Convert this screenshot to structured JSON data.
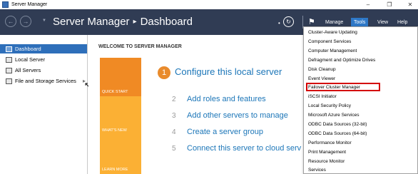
{
  "window": {
    "title": "Server Manager"
  },
  "header": {
    "breadcrumb_app": "Server Manager",
    "breadcrumb_separator": "▸",
    "breadcrumb_page": "Dashboard",
    "menus": [
      {
        "label": "Manage"
      },
      {
        "label": "Tools"
      },
      {
        "label": "View"
      },
      {
        "label": "Help"
      }
    ]
  },
  "sidebar": {
    "items": [
      {
        "label": "Dashboard"
      },
      {
        "label": "Local Server"
      },
      {
        "label": "All Servers"
      },
      {
        "label": "File and Storage Services"
      }
    ]
  },
  "main": {
    "welcome_heading": "WELCOME TO SERVER MANAGER",
    "tiles": [
      {
        "label": "QUICK START"
      },
      {
        "label": "WHAT'S NEW"
      },
      {
        "label": "LEARN MORE"
      }
    ],
    "steps": [
      {
        "number": "1",
        "text": "Configure this local server"
      },
      {
        "number": "2",
        "text": "Add roles and features"
      },
      {
        "number": "3",
        "text": "Add other servers to manage"
      },
      {
        "number": "4",
        "text": "Create a server group"
      },
      {
        "number": "5",
        "text": "Connect this server to cloud serv"
      }
    ]
  },
  "tools_menu": {
    "items": [
      {
        "label": "Cluster-Aware Updating"
      },
      {
        "label": "Component Services"
      },
      {
        "label": "Computer Management"
      },
      {
        "label": "Defragment and Optimize Drives"
      },
      {
        "label": "Disk Cleanup"
      },
      {
        "label": "Event Viewer"
      },
      {
        "label": "Failover Cluster Manager"
      },
      {
        "label": "iSCSI Initiator"
      },
      {
        "label": "Local Security Policy"
      },
      {
        "label": "Microsoft Azure Services"
      },
      {
        "label": "ODBC Data Sources (32-bit)"
      },
      {
        "label": "ODBC Data Sources (64-bit)"
      },
      {
        "label": "Performance Monitor"
      },
      {
        "label": "Print Management"
      },
      {
        "label": "Resource Monitor"
      },
      {
        "label": "Services"
      }
    ],
    "highlighted_item": "Failover Cluster Manager"
  },
  "colors": {
    "header_bg": "#303c54",
    "active_menu": "#2e78c7",
    "sidebar_active": "#2e6fba",
    "tile_orange": "#f08a24",
    "tile_yellow": "#fbb034",
    "link_blue": "#1c76b8",
    "highlight_red": "#d40000"
  },
  "icons": [
    "app-icon",
    "back-arrow-icon",
    "forward-arrow-icon",
    "refresh-icon",
    "flag-icon",
    "minimize-icon",
    "restore-icon",
    "close-icon",
    "dashboard-icon",
    "server-icon",
    "servers-icon",
    "storage-icon",
    "chevron-right-icon",
    "mouse-cursor-icon"
  ]
}
